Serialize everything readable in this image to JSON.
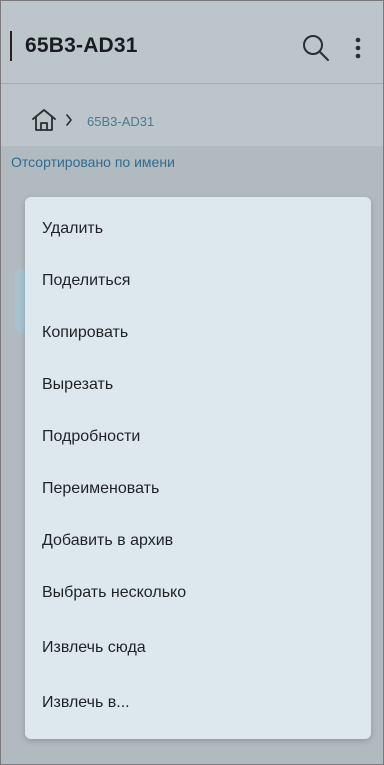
{
  "appbar": {
    "title": "65B3-AD31",
    "search_icon": "search-icon",
    "more_icon": "more-vert-icon"
  },
  "breadcrumb": {
    "home_icon": "home-icon",
    "separator_icon": "chevron-right-icon",
    "current": "65B3-AD31"
  },
  "sort_label": "Отсортировано по имени",
  "context_menu": {
    "items": [
      "Удалить",
      "Поделиться",
      "Копировать",
      "Вырезать",
      "Подробности",
      "Переименовать",
      "Добавить в архив",
      "Выбрать несколько",
      "Извлечь сюда",
      "Извлечь в..."
    ]
  },
  "colors": {
    "accent": "#2e6d91",
    "menu_bg": "#dce8ee",
    "scrim": "#b0babf"
  }
}
